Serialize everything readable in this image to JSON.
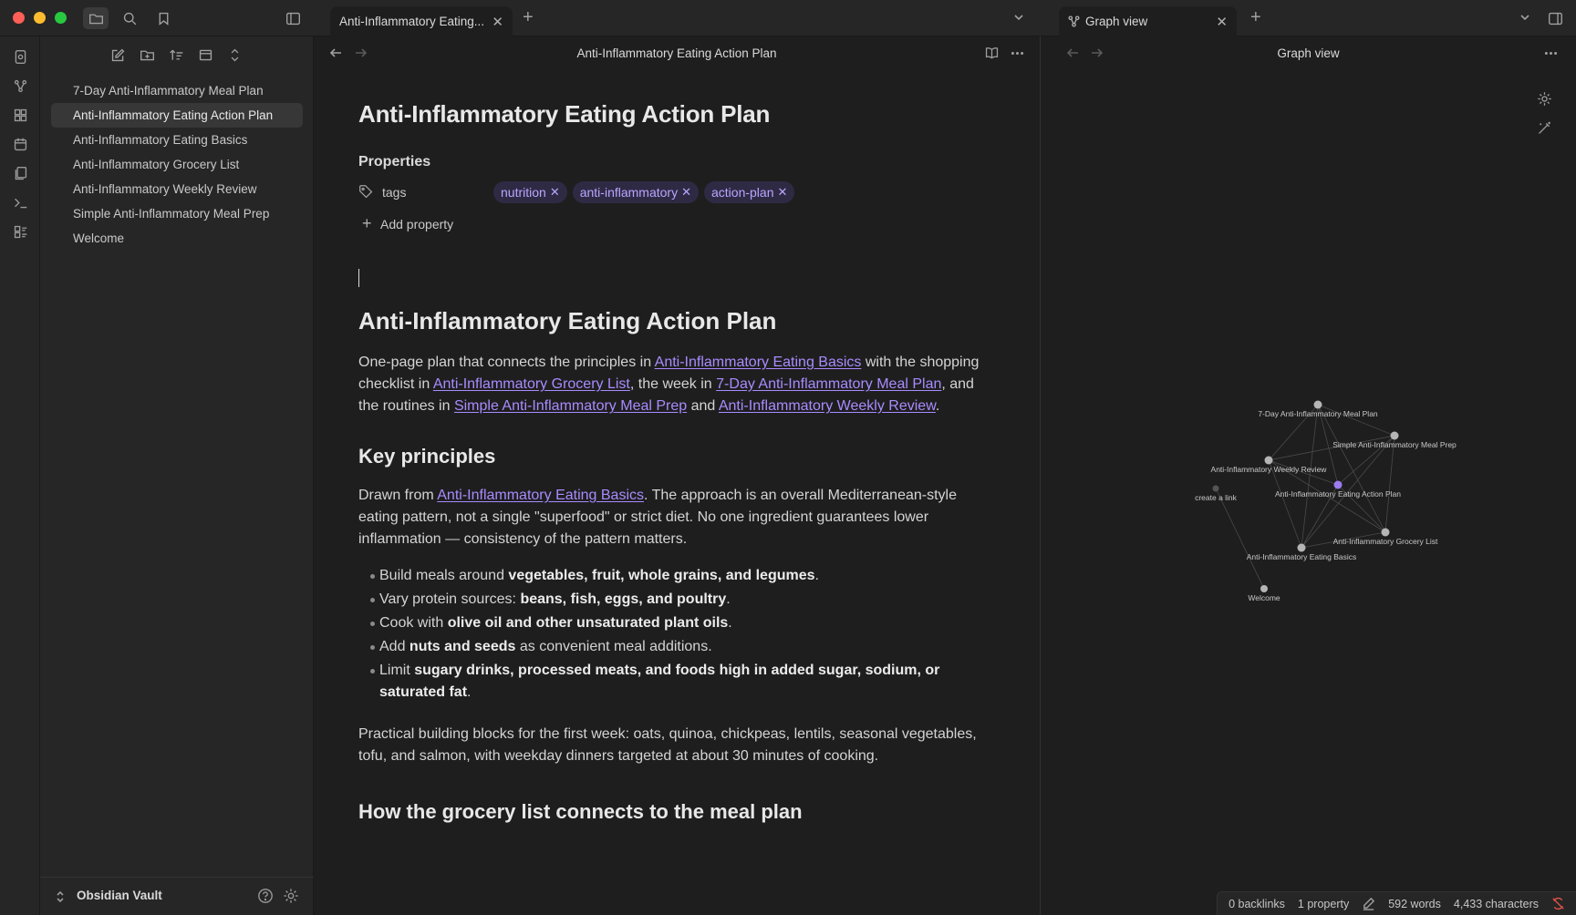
{
  "window": {
    "tabs": [
      {
        "label": "Anti-Inflammatory Eating..."
      },
      {
        "label": "Graph view"
      }
    ]
  },
  "sidebar": {
    "files": [
      {
        "label": "7-Day Anti-Inflammatory Meal Plan"
      },
      {
        "label": "Anti-Inflammatory Eating Action Plan",
        "active": true
      },
      {
        "label": "Anti-Inflammatory Eating Basics"
      },
      {
        "label": "Anti-Inflammatory Grocery List"
      },
      {
        "label": "Anti-Inflammatory Weekly Review"
      },
      {
        "label": "Simple Anti-Inflammatory Meal Prep"
      },
      {
        "label": "Welcome"
      }
    ],
    "vault_name": "Obsidian Vault"
  },
  "editor": {
    "pane_title": "Anti-Inflammatory Eating Action Plan",
    "title": "Anti-Inflammatory Eating Action Plan",
    "properties_label": "Properties",
    "property_key": "tags",
    "tags": [
      "nutrition",
      "anti-inflammatory",
      "action-plan"
    ],
    "add_property": "Add property",
    "heading": "Anti-Inflammatory Eating Action Plan",
    "intro": {
      "t1": "One-page plan that connects the principles in ",
      "l1": "Anti-Inflammatory Eating Basics",
      "t2": " with the shopping checklist in ",
      "l2": "Anti-Inflammatory Grocery List",
      "t3": ", the week in ",
      "l3": "7-Day Anti-Inflammatory Meal Plan",
      "t4": ", and the routines in ",
      "l4": "Simple Anti-Inflammatory Meal Prep",
      "t5": " and ",
      "l5": "Anti-Inflammatory Weekly Review",
      "t6": "."
    },
    "key_principles": "Key principles",
    "drawn": {
      "t1": "Drawn from ",
      "l1": "Anti-Inflammatory Eating Basics",
      "t2": ". The approach is an overall Mediterranean-style eating pattern, not a single \"superfood\" or strict diet. No one ingredient guarantees lower inflammation — consistency of the pattern matters."
    },
    "bullets": [
      {
        "pre": "Build meals around ",
        "bold": "vegetables, fruit, whole grains, and legumes",
        "post": "."
      },
      {
        "pre": "Vary protein sources: ",
        "bold": "beans, fish, eggs, and poultry",
        "post": "."
      },
      {
        "pre": "Cook with ",
        "bold": "olive oil and other unsaturated plant oils",
        "post": "."
      },
      {
        "pre": "Add ",
        "bold": "nuts and seeds",
        "post": " as convenient meal additions."
      },
      {
        "pre": "Limit ",
        "bold": "sugary drinks, processed meats, and foods high in added sugar, sodium, or saturated fat",
        "post": "."
      }
    ],
    "building_blocks": "Practical building blocks for the first week: oats, quinoa, chickpeas, lentils, seasonal vegetables, tofu, and salmon, with weekday dinners targeted at about 30 minutes of cooking.",
    "heading2": "How the grocery list connects to the meal plan"
  },
  "graph": {
    "pane_title": "Graph view",
    "nodes": [
      {
        "label": "7-Day Anti-Inflammatory Meal Plan"
      },
      {
        "label": "Simple Anti-Inflammatory Meal Prep"
      },
      {
        "label": "Anti-Inflammatory Weekly Review"
      },
      {
        "label": "create a link"
      },
      {
        "label": "Anti-Inflammatory Eating Action Plan"
      },
      {
        "label": "Anti-Inflammatory Grocery List"
      },
      {
        "label": "Anti-Inflammatory Eating Basics"
      },
      {
        "label": "Welcome"
      }
    ]
  },
  "status": {
    "backlinks": "0 backlinks",
    "properties": "1 property",
    "words": "592 words",
    "characters": "4,433 characters"
  },
  "colors": {
    "accent": "#a98bff",
    "active_node": "#9b7cf0",
    "node": "#b5b5b5"
  }
}
